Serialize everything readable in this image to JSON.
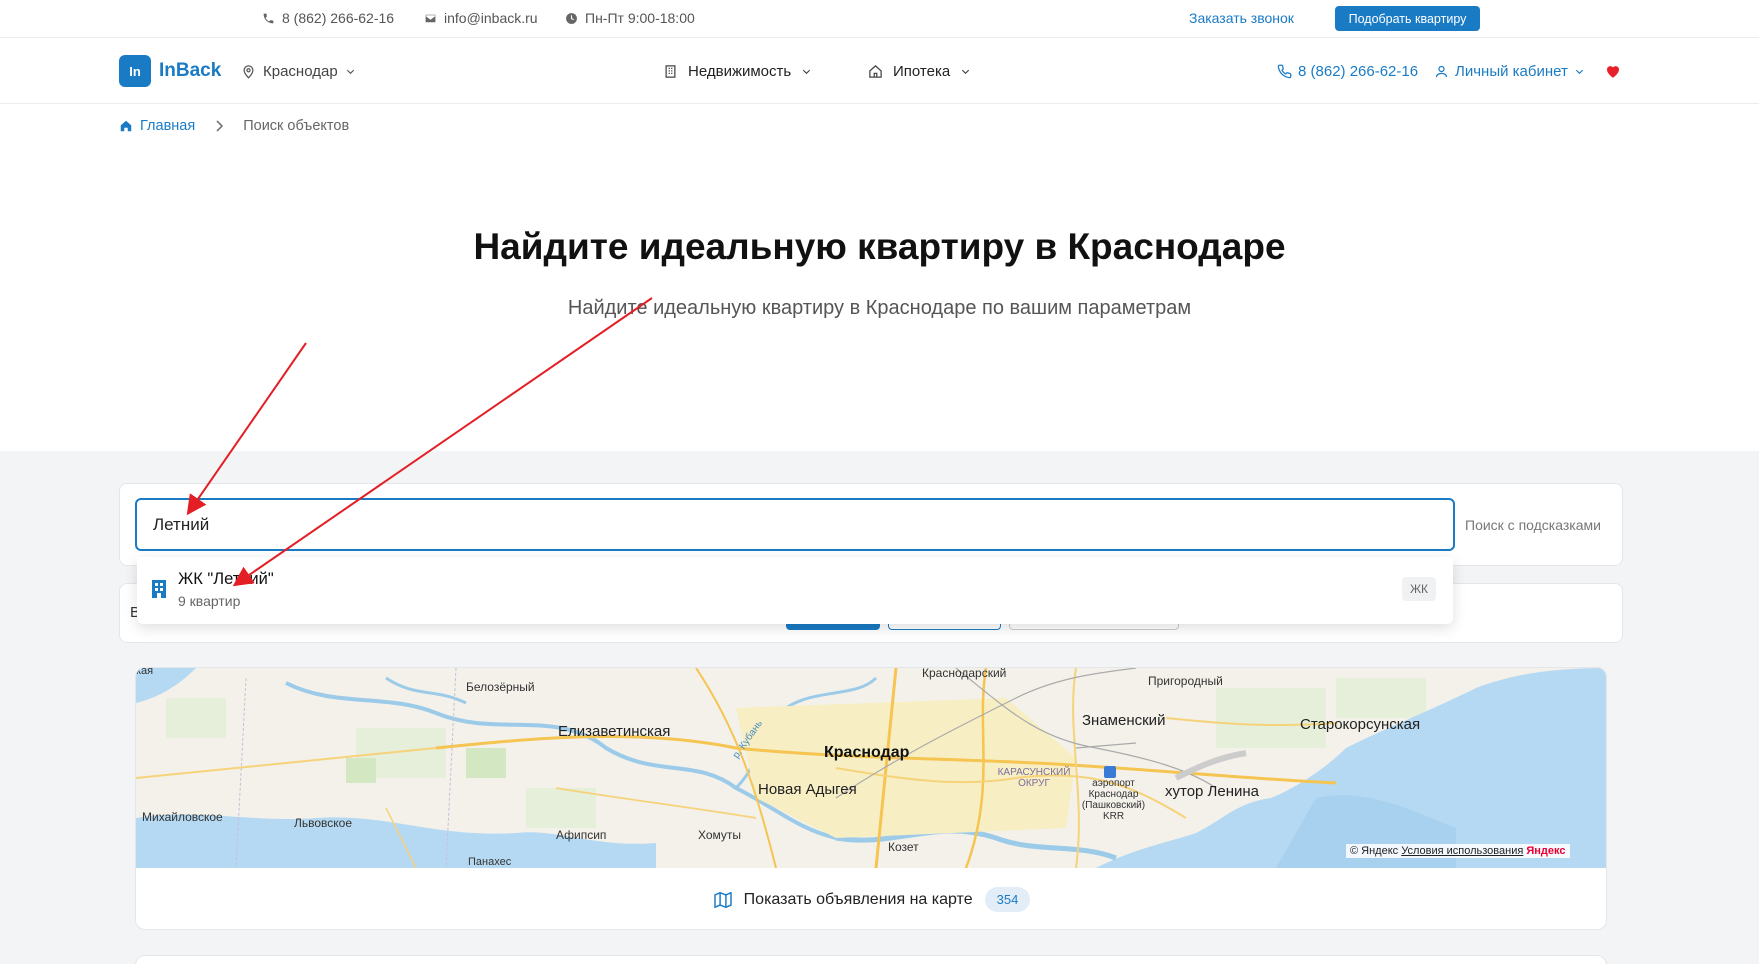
{
  "topbar": {
    "phone": "8 (862) 266-62-16",
    "email": "info@inback.ru",
    "hours": "Пн-Пт 9:00-18:00",
    "order_call": "Заказать звонок",
    "pick_apartment": "Подобрать квартиру"
  },
  "header": {
    "logo_mark": "In",
    "logo_text": "InBack",
    "city": "Краснодар",
    "nav": {
      "realty": "Недвижимость",
      "mortgage": "Ипотека"
    },
    "phone": "8 (862) 266-62-16",
    "account": "Личный кабинет"
  },
  "breadcrumb": {
    "home": "Главная",
    "current": "Поиск объектов"
  },
  "hero": {
    "title": "Найдите идеальную квартиру в Краснодаре",
    "subtitle": "Найдите идеальную квартиру в Краснодаре по вашим параметрам"
  },
  "search": {
    "value": "Летний",
    "hint_label": "Поиск с подсказками"
  },
  "filter": {
    "partial_letter": "В"
  },
  "dropdown": {
    "title": "ЖК \"Летний\"",
    "subtitle": "9 квартир",
    "badge": "ЖК"
  },
  "map": {
    "labels": {
      "krasnodarsky": "Краснодарский",
      "belozerny": "Белозёрный",
      "prigorodny": "Пригородный",
      "znamensky": "Знаменский",
      "starokorsunskaya": "Старокорсунская",
      "elizavetinskaya": "Елизаветинская",
      "krasnodar": "Краснодар",
      "kuban": "р. Кубань",
      "karasunsky": "КАРАСУНСКИЙ ОКРУГ",
      "airport": "аэропорт Краснодар (Пашковский) KRR",
      "novaya_adygeya": "Новая Адыгея",
      "khutor_lenina": "хутор Ленина",
      "mikhailovskoe": "Михайловское",
      "lvovskoe": "Львовское",
      "afipsip": "Афипсип",
      "khomuty": "Хомуты",
      "kozet": "Козет",
      "panakhes": "Панахес",
      "kaya": "кая"
    },
    "copyright": "© Яндекс",
    "terms": "Условия использования",
    "brand": "Яндекс",
    "show_on_map": "Показать объявления на карте",
    "count": "354"
  },
  "colors": {
    "accent": "#1a7bc5",
    "heart": "#e8202a",
    "arrow": "#e31e24"
  }
}
